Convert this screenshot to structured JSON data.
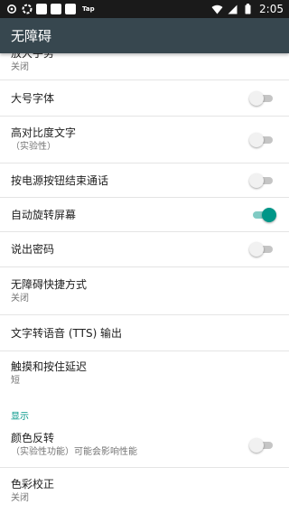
{
  "status_bar": {
    "app_label": "Tap",
    "time": "2:05",
    "left_icons": [
      "sync-icon",
      "settings-ring-icon",
      "notification-square-icon",
      "notification-square-icon",
      "notification-square-icon"
    ],
    "right_icons": [
      "wifi-icon",
      "signal-icon",
      "battery-icon"
    ]
  },
  "app_bar": {
    "title": "无障碍"
  },
  "settings": [
    {
      "title": "放大手势",
      "summary": "关闭"
    },
    {
      "title": "大号字体",
      "switch": false
    },
    {
      "title": "高对比度文字",
      "summary": "（实验性）",
      "switch": false
    },
    {
      "title": "按电源按钮结束通话",
      "switch": false
    },
    {
      "title": "自动旋转屏幕",
      "switch": true
    },
    {
      "title": "说出密码",
      "switch": false
    },
    {
      "title": "无障碍快捷方式",
      "summary": "关闭"
    },
    {
      "title": "文字转语音 (TTS) 输出"
    },
    {
      "title": "触摸和按住延迟",
      "summary": "短"
    }
  ],
  "display_section": {
    "header": "显示",
    "items": [
      {
        "title": "颜色反转",
        "summary": "（实验性功能）可能会影响性能",
        "switch": false
      },
      {
        "title": "色彩校正",
        "summary": "关闭"
      }
    ]
  },
  "colors": {
    "status_bar": "#1a1a1a",
    "app_bar": "#37474f",
    "accent": "#009688",
    "switch_off_track": "#c5c5c5"
  }
}
